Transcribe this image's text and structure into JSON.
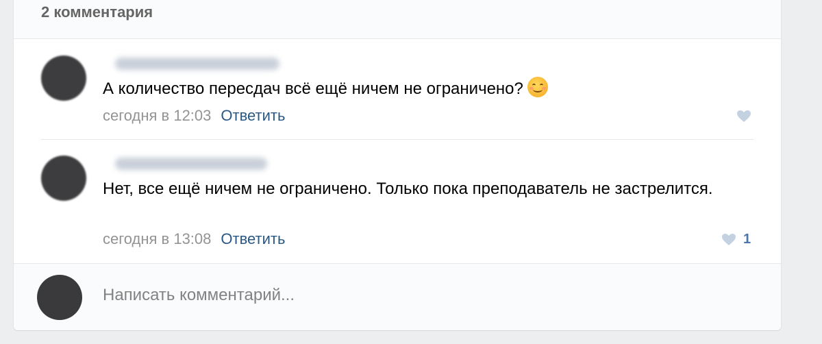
{
  "header": {
    "title": "2 комментария"
  },
  "comments": [
    {
      "text": "А количество пересдач всё ещё ничем не ограничено?",
      "emoji": "smiling-face-emoji",
      "time": "сегодня в 12:03",
      "reply_label": "Ответить",
      "likes": ""
    },
    {
      "text": "Нет, все ещё ничем не ограничено. Только пока преподаватель не застрелится.",
      "time": "сегодня в 13:08",
      "reply_label": "Ответить",
      "likes": "1"
    }
  ],
  "composer": {
    "placeholder": "Написать комментарий..."
  },
  "colors": {
    "link": "#2a5885",
    "meta": "#939393",
    "like": "#4a76a8",
    "background": "#edeef0"
  }
}
